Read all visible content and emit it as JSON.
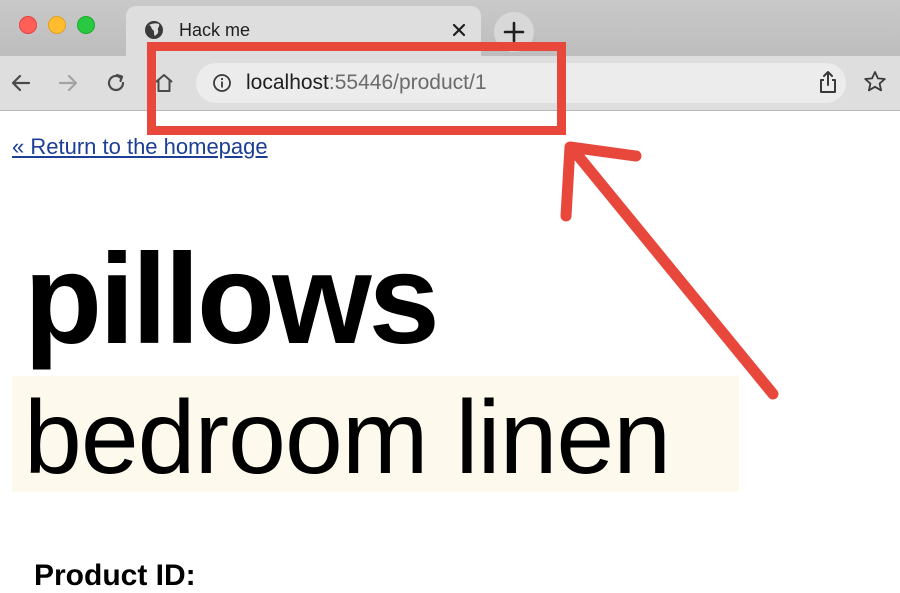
{
  "browser": {
    "tab": {
      "title": "Hack me",
      "icon": "globe-icon"
    },
    "new_tab_label": "+",
    "address_bar": {
      "url_host": "localhost",
      "url_path": ":55446/product/1"
    }
  },
  "page": {
    "return_link": "« Return to the homepage",
    "product_name": "pillows",
    "product_category": "bedroom linen",
    "next_heading_partial": "Product ID: "
  },
  "annotation": {
    "color": "#e8473c"
  },
  "colors": {
    "link": "#1c3f95",
    "category_highlight": "#fdf9ec",
    "close_button": "#ff5f57",
    "minimize_button": "#febc2e",
    "zoom_button": "#28c840"
  }
}
